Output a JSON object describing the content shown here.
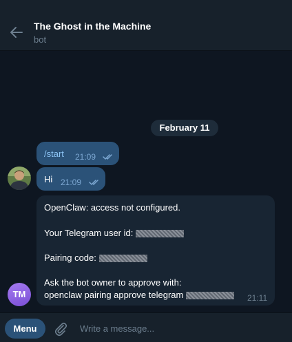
{
  "header": {
    "title": "The Ghost in the Machine",
    "subtitle": "bot",
    "back_icon": "arrow-left-icon"
  },
  "chat": {
    "date_separator": "February 11",
    "messages": [
      {
        "direction": "outgoing",
        "text": "/start",
        "time": "21:09",
        "status": "read"
      },
      {
        "direction": "outgoing",
        "text": "Hi",
        "time": "21:09",
        "status": "read"
      },
      {
        "direction": "incoming",
        "lines": [
          "OpenClaw: access not configured.",
          "Your Telegram user id:",
          "Pairing code:",
          "Ask the bot owner to approve with:",
          "openclaw pairing approve telegram"
        ],
        "time": "21:11",
        "sender_initials": "TM"
      }
    ]
  },
  "composer": {
    "menu_label": "Menu",
    "placeholder": "Write a message...",
    "attach_icon": "paperclip-icon"
  },
  "colors": {
    "background": "#0e1621",
    "header": "#17212b",
    "outgoing_bubble": "#2b5278",
    "incoming_bubble": "#182533",
    "accent": "#5eb5f7"
  }
}
